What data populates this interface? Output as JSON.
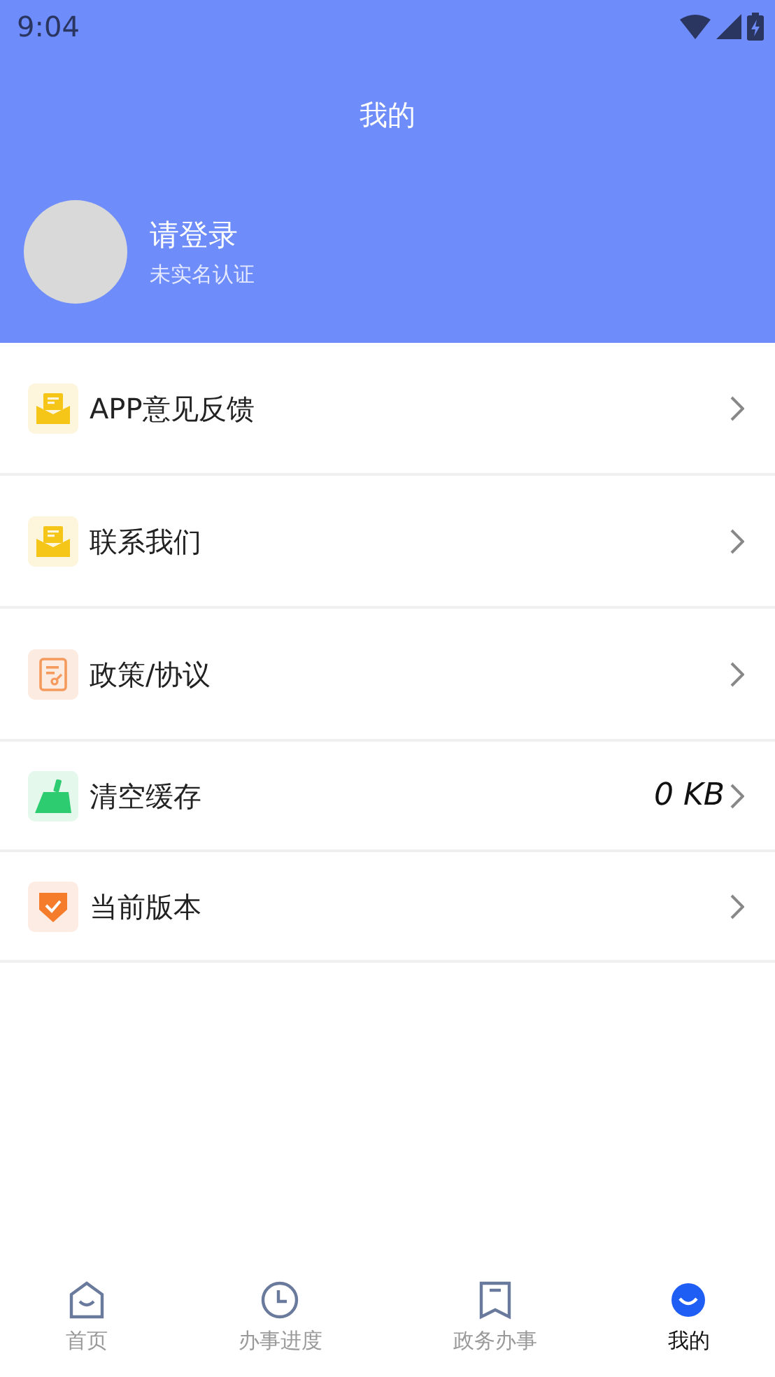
{
  "status_bar": {
    "time": "9:04"
  },
  "header": {
    "title": "我的"
  },
  "profile": {
    "name": "请登录",
    "subtitle": "未实名认证"
  },
  "menu": [
    {
      "kind": "mail",
      "label": "APP意见反馈"
    },
    {
      "kind": "mail",
      "label": "联系我们"
    },
    {
      "kind": "policy",
      "label": "政策/协议"
    },
    {
      "kind": "broom",
      "label": "清空缓存",
      "value": "0 KB"
    },
    {
      "kind": "shield",
      "label": "当前版本"
    }
  ],
  "tabs": [
    {
      "kind": "home",
      "label": "首页",
      "selected": false
    },
    {
      "kind": "clock",
      "label": "办事进度",
      "selected": false
    },
    {
      "kind": "bookmark",
      "label": "政务办事",
      "selected": false
    },
    {
      "kind": "smile",
      "label": "我的",
      "selected": true
    }
  ]
}
